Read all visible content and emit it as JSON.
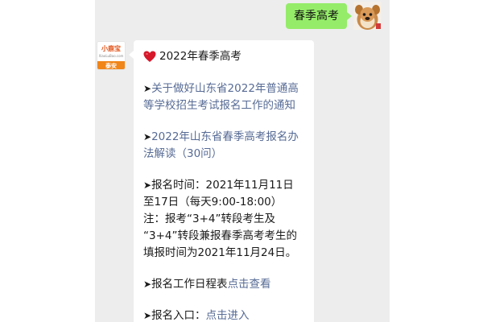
{
  "outgoing": {
    "text": "春季高考"
  },
  "sender": {
    "brand": "小鹿宝",
    "url": "XiaoLuBao.com",
    "city": "泰安"
  },
  "message": {
    "title": "2022年春季高考",
    "link1": "关于做好山东省2022年普通高等学校招生考试报名工作的通知",
    "link2": "2022年山东省春季高考报名办法解读（30问）",
    "reg_time": "报名时间：2021年11月11日至17日（每天9:00-18:00）",
    "note": "注：报考“3+4”转段考生及 “3+4”转段兼报春季高考考生的填报时间为2021年11月24日。",
    "schedule_text": "报名工作日程表",
    "schedule_link": "点击查看",
    "entry_text": "报名入口：",
    "entry_link": "点击进入"
  },
  "colors": {
    "chat_bg": "#ededed",
    "outgoing_bubble": "#95ec69",
    "link": "#576b95",
    "avatar_orange": "#f08519"
  },
  "icons": {
    "title_icon": "heart-icon",
    "bullet_icon": "arrow-bullet-icon"
  }
}
